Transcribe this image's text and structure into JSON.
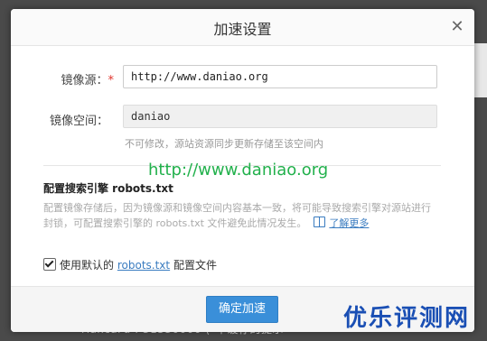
{
  "dialog": {
    "title": "加速设置",
    "close_glyph": "✕"
  },
  "form": {
    "mirror_source_label": "镜像源：",
    "mirror_source_required": "*",
    "mirror_source_value": "http://www.daniao.org",
    "mirror_space_label": "镜像空间：",
    "mirror_space_value": "daniao",
    "mirror_space_hint": "不可修改，源站资源同步更新存储至该空间内"
  },
  "watermark_url": "http://www.daniao.org",
  "robots": {
    "section_title": "配置搜索引擎 robots.txt",
    "description": "配置镜像存储后，因为镜像源和镜像空间内容基本一致，将可能导致搜索引擎对源站进行封锁，可配置搜索引擎的 robots.txt 文件避免此情况发生。",
    "learn_more": "了解更多",
    "checkbox_prefix": "使用默认的",
    "checkbox_link": "robots.txt",
    "checkbox_suffix": "配置文件",
    "checked": true
  },
  "footer": {
    "confirm_label": "确定加速"
  },
  "background": {
    "bottom_text": "максага : 31530000 (*不缓存的提示"
  },
  "corner_watermark": "优乐评测网",
  "colors": {
    "accent": "#3a8fd9",
    "link": "#3a7cc0",
    "required": "#e0342c",
    "watermark_green": "#22b14c",
    "corner_blue": "#1a4fb4"
  }
}
